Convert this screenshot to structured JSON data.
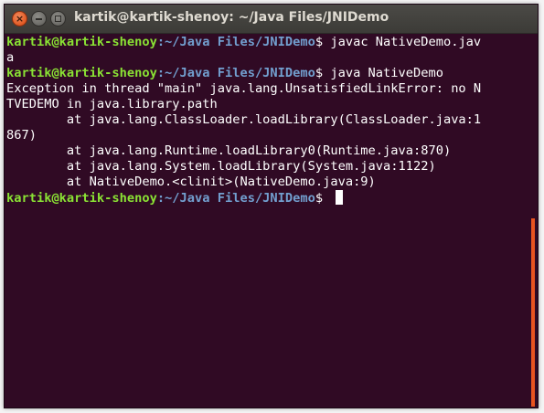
{
  "window": {
    "title": "kartik@kartik-shenoy: ~/Java Files/JNIDemo",
    "buttons": {
      "close_glyph": "×"
    }
  },
  "colors": {
    "background": "#300a24",
    "prompt_user": "#8ae234",
    "prompt_path": "#729fcf",
    "text": "#ffffff",
    "scrollbar": "#e95420",
    "close_button": "#e05a24"
  },
  "terminal": {
    "prompt_user": "kartik@kartik-shenoy",
    "prompt_path": ":~/Java Files/JNIDemo",
    "lines": [
      {
        "type": "prompt",
        "command": "$ javac NativeDemo.jav"
      },
      {
        "type": "output",
        "text": "a"
      },
      {
        "type": "prompt",
        "command": "$ java NativeDemo"
      },
      {
        "type": "output",
        "text": "Exception in thread \"main\" java.lang.UnsatisfiedLinkError: no N"
      },
      {
        "type": "output",
        "text": "TVEDEMO in java.library.path"
      },
      {
        "type": "output",
        "text": "        at java.lang.ClassLoader.loadLibrary(ClassLoader.java:1"
      },
      {
        "type": "output",
        "text": "867)"
      },
      {
        "type": "output",
        "text": "        at java.lang.Runtime.loadLibrary0(Runtime.java:870)"
      },
      {
        "type": "output",
        "text": "        at java.lang.System.loadLibrary(System.java:1122)"
      },
      {
        "type": "output",
        "text": "        at NativeDemo.<clinit>(NativeDemo.java:9)"
      },
      {
        "type": "prompt",
        "command": "$ "
      }
    ]
  }
}
